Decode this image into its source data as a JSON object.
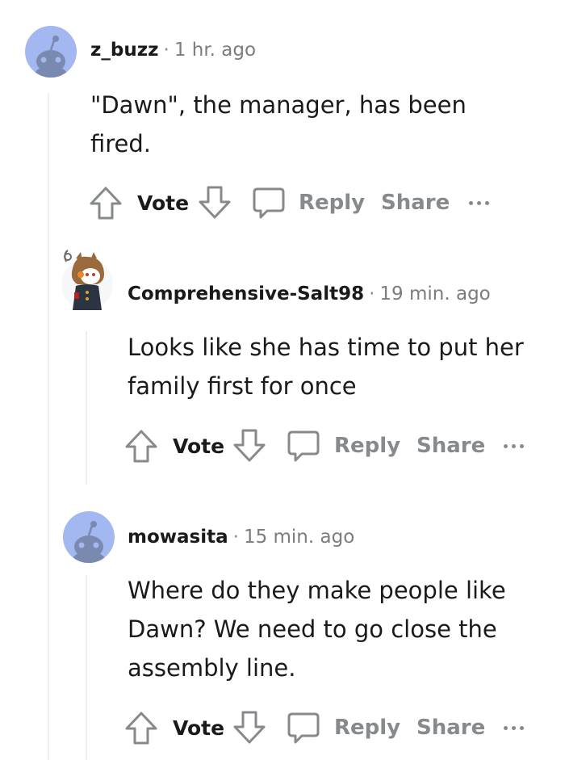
{
  "comments": [
    {
      "username": "z_buzz",
      "separator": "·",
      "time": "1 hr. ago",
      "lines": [
        "\"Dawn\", the manager, has been",
        "fired."
      ],
      "vote_label": "Vote",
      "reply_label": "Reply",
      "share_label": "Share"
    },
    {
      "username": "Comprehensive-Salt98",
      "separator": "·",
      "time": "19 min. ago",
      "lines": [
        "Looks like she has time to put her",
        "family first for once"
      ],
      "vote_label": "Vote",
      "reply_label": "Reply",
      "share_label": "Share"
    },
    {
      "username": "mowasita",
      "separator": "·",
      "time": "15 min. ago",
      "lines": [
        "Where do they make people like",
        "Dawn? We need to go close the",
        "assembly line."
      ],
      "vote_label": "Vote",
      "reply_label": "Reply",
      "share_label": "Share"
    }
  ],
  "colors": {
    "text": "#1a1a1b",
    "muted": "#878a8c",
    "avatar_bg": "#a3b8f0",
    "avatar_fg": "#7a89b0",
    "thread_line": "#edeff1"
  },
  "icons": [
    "upvote-icon",
    "downvote-icon",
    "comment-bubble-icon",
    "more-options-icon",
    "snoo-avatar-icon"
  ]
}
